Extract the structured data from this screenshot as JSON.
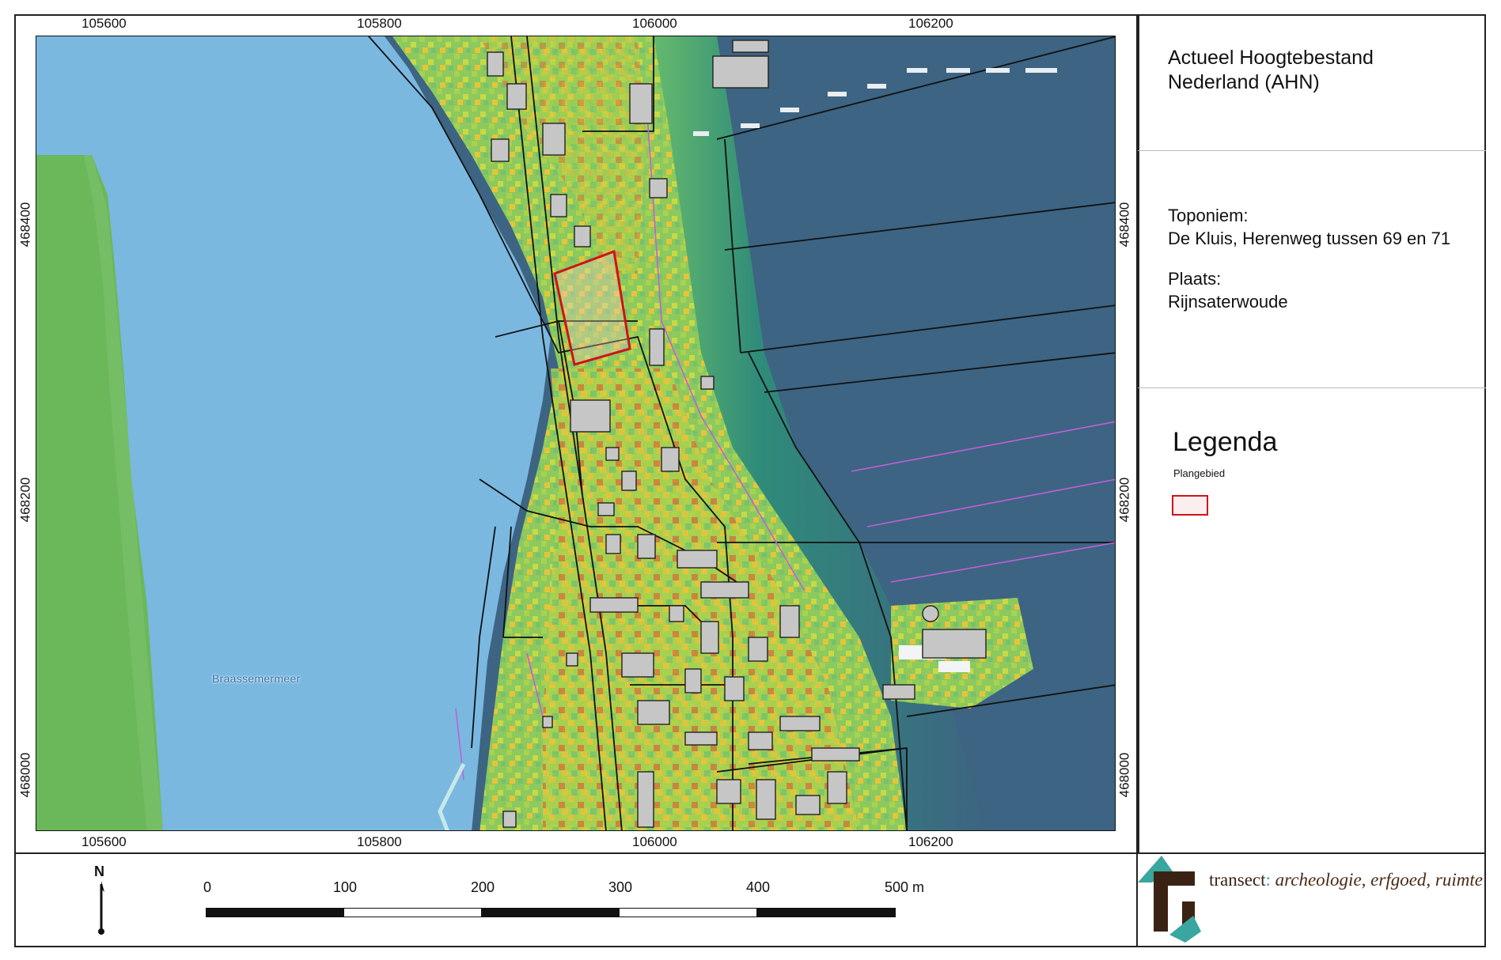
{
  "map": {
    "coords_top": [
      "105600",
      "105800",
      "106000",
      "106200"
    ],
    "coords_bottom": [
      "105600",
      "105800",
      "106000",
      "106200"
    ],
    "coords_left": [
      "468400",
      "468200",
      "468000"
    ],
    "coords_right": [
      "468400",
      "468200",
      "468000"
    ],
    "lake_label": "Braassemermeer",
    "colors": {
      "lake": "#7ab8e0",
      "meadow_left": "#6ab85a",
      "land_low": "#80c46a",
      "land_mid": "#a9d24e",
      "land_high": "#e6c43a",
      "land_peak": "#d47a3a",
      "polder_dark": "#3d6482",
      "polder_edge": "#2f8b7a",
      "building": "#c6c6c6",
      "plan_area": "#d0121a",
      "purple_line": "#c060d8"
    }
  },
  "panel": {
    "title_line1": "Actueel Hoogtebestand",
    "title_line2": "Nederland (AHN)",
    "toponiem_label": "Toponiem:",
    "toponiem_value": "De Kluis, Herenweg tussen 69 en 71",
    "plaats_label": "Plaats:",
    "plaats_value": "Rijnsaterwoude"
  },
  "legend": {
    "title": "Legenda",
    "items": [
      {
        "label": "Plangebied",
        "color": "#d0121a"
      }
    ]
  },
  "scale": {
    "labels": [
      "0",
      "100",
      "200",
      "300",
      "400",
      "500 m"
    ],
    "north": "N"
  },
  "logo": {
    "brand": "transect",
    "colon": ":",
    "tagline": " archeologie, erfgoed, ruimte"
  }
}
